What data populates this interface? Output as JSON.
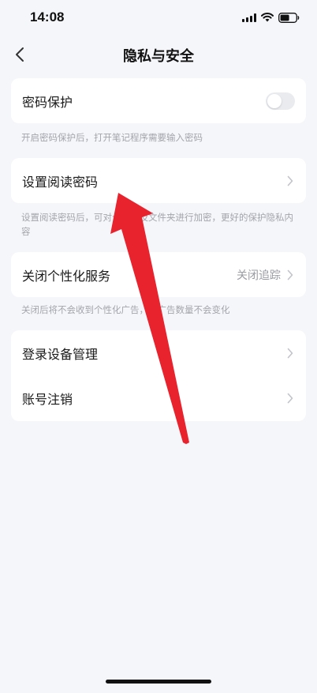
{
  "status_bar": {
    "time": "14:08"
  },
  "nav": {
    "title": "隐私与安全",
    "back_icon": "chevron-left-icon"
  },
  "password_protection": {
    "label": "密码保护",
    "toggle_on": false,
    "hint": "开启密码保护后，打开笔记程序需要输入密码"
  },
  "reading_password": {
    "label": "设置阅读密码",
    "hint": "设置阅读密码后，可对个文档及文件夹进行加密，更好的保护隐私内容"
  },
  "personalization": {
    "label": "关闭个性化服务",
    "value": "关闭追踪",
    "hint": "关闭后将不会收到个性化广告，但广告数量不会变化"
  },
  "account": {
    "items": [
      {
        "label": "登录设备管理"
      },
      {
        "label": "账号注销"
      }
    ]
  },
  "annotation": {
    "arrow_color": "#e8232e"
  },
  "colors": {
    "background": "#f5f6fa",
    "card": "#ffffff",
    "hint_text": "#a3a5ac",
    "chevron": "#c2c4ca"
  }
}
